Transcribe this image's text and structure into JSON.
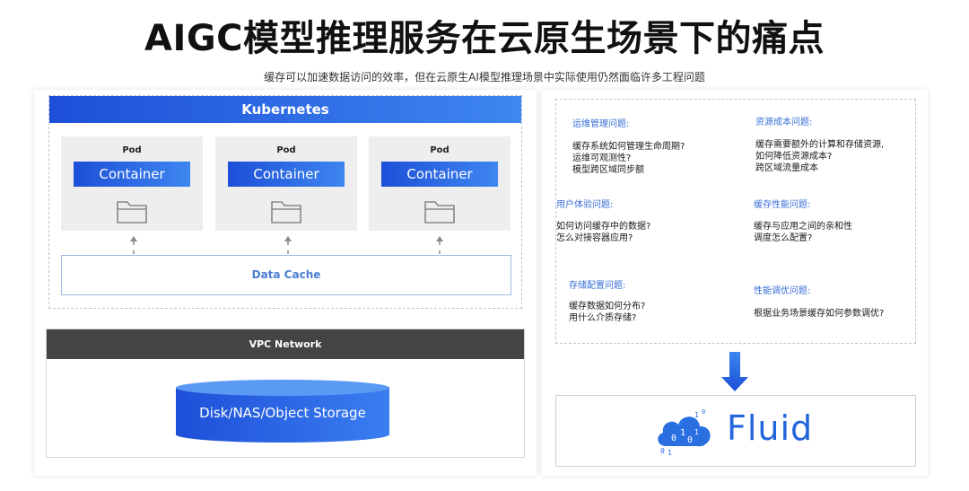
{
  "title": "AIGC模型推理服务在云原生场景下的痛点",
  "subtitle": "缓存可以加速数据访问的效率，但在云原生AI模型推理场景中实际使用仍然面临许多工程问题",
  "left": {
    "kubernetes_label": "Kubernetes",
    "pods": [
      {
        "label": "Pod",
        "container": "Container"
      },
      {
        "label": "Pod",
        "container": "Container"
      },
      {
        "label": "Pod",
        "container": "Container"
      }
    ],
    "cache_label": "Data Cache",
    "vpc_label": "VPC Network",
    "storage_label": "Disk/NAS/Object Storage"
  },
  "right": {
    "issues": [
      {
        "title": "运维管理问题:",
        "lines": [
          "缓存系统如何管理生命周期?",
          "运维可观测性?",
          "模型跨区域同步额"
        ]
      },
      {
        "title": "资源成本问题:",
        "lines": [
          "缓存需要额外的计算和存储资源,",
          "如何降低资源成本?",
          "跨区域流量成本"
        ]
      },
      {
        "title": "用户体验问题:",
        "lines": [
          "如何访问缓存中的数据?",
          "怎么对接容器应用?"
        ]
      },
      {
        "title": "缓存性能问题:",
        "lines": [
          "缓存与应用之间的亲和性",
          "调度怎么配置?"
        ]
      },
      {
        "title": "存储配置问题:",
        "lines": [
          "缓存数据如何分布?",
          "用什么介质存储?"
        ]
      },
      {
        "title": "性能调优问题:",
        "lines": [
          "根据业务场景缓存如何参数调优?"
        ]
      }
    ],
    "logo_text": "Fluid"
  },
  "colors": {
    "accent_blue": "#1d4fd8",
    "issue_title": "#3a6fd6",
    "vpc_bar": "#444444",
    "fluid_blue": "#2266dd"
  }
}
